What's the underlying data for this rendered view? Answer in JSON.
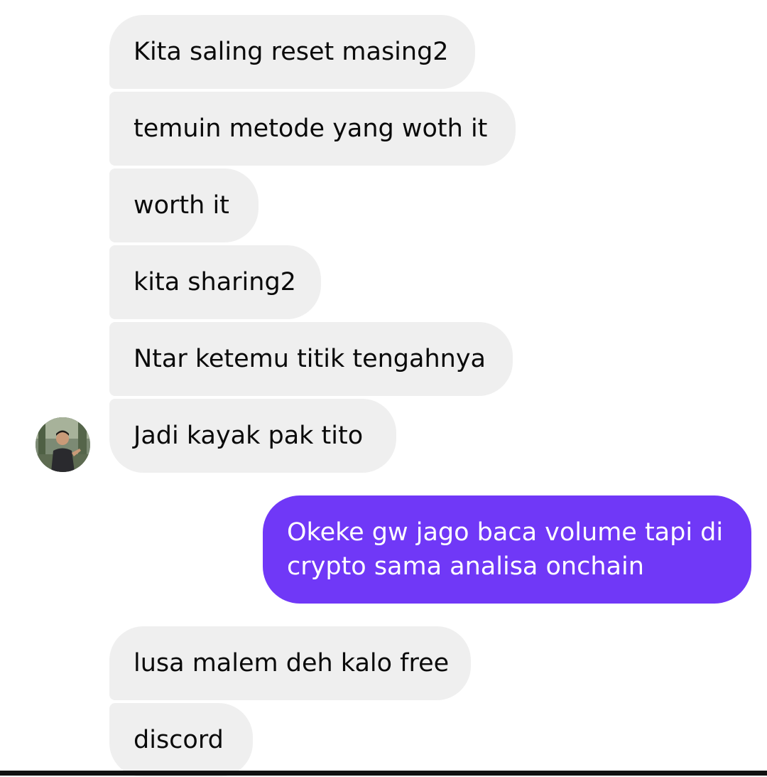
{
  "thread": {
    "messages": [
      {
        "text": "Kita saling reset masing2",
        "direction": "incoming"
      },
      {
        "text": "temuin metode yang woth it",
        "direction": "incoming"
      },
      {
        "text": "worth it",
        "direction": "incoming"
      },
      {
        "text": "kita sharing2",
        "direction": "incoming"
      },
      {
        "text": "Ntar ketemu titik tengahnya",
        "direction": "incoming"
      },
      {
        "text": "Jadi kayak pak tito",
        "direction": "incoming"
      },
      {
        "text": "Okeke gw jago baca volume tapi di crypto sama analisa onchain",
        "direction": "outgoing"
      },
      {
        "text": "lusa malem deh kalo free",
        "direction": "incoming"
      },
      {
        "text": "discord",
        "direction": "incoming"
      }
    ]
  },
  "colors": {
    "incoming_bubble": "#efefef",
    "outgoing_bubble": "#7038f7",
    "incoming_text": "#0a0a0a",
    "outgoing_text": "#ffffff"
  },
  "icons": {
    "avatar": "sender-avatar-photo"
  }
}
